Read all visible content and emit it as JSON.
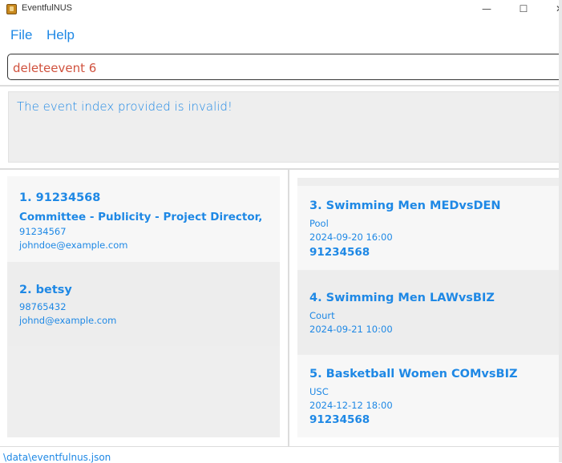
{
  "window": {
    "title": "EventfulNUS",
    "minimize_glyph": "—",
    "maximize_glyph": "☐",
    "close_glyph": "✕"
  },
  "menu": {
    "file": "File",
    "help": "Help"
  },
  "command": {
    "value": "deleteevent 6"
  },
  "result": {
    "message": "The event index provided is invalid!"
  },
  "persons": [
    {
      "title": "1. 91234568",
      "roles": "Committee - Publicity - Project Director,",
      "phone": "91234567",
      "email": "johndoe@example.com"
    },
    {
      "title": "2. betsy",
      "phone": "98765432",
      "email": "johnd@example.com"
    }
  ],
  "events": [
    {
      "title": "3. Swimming Men MEDvsDEN",
      "venue": "Pool",
      "datetime": "2024-09-20 16:00",
      "participant": "91234568"
    },
    {
      "title": "4. Swimming Men LAWvsBIZ",
      "venue": "Court",
      "datetime": "2024-09-21 10:00"
    },
    {
      "title": "5. Basketball Women COMvsBIZ",
      "venue": "USC",
      "datetime": "2024-12-12 18:00",
      "participant": "91234568"
    }
  ],
  "status": {
    "path": "\\data\\eventfulnus.json"
  }
}
